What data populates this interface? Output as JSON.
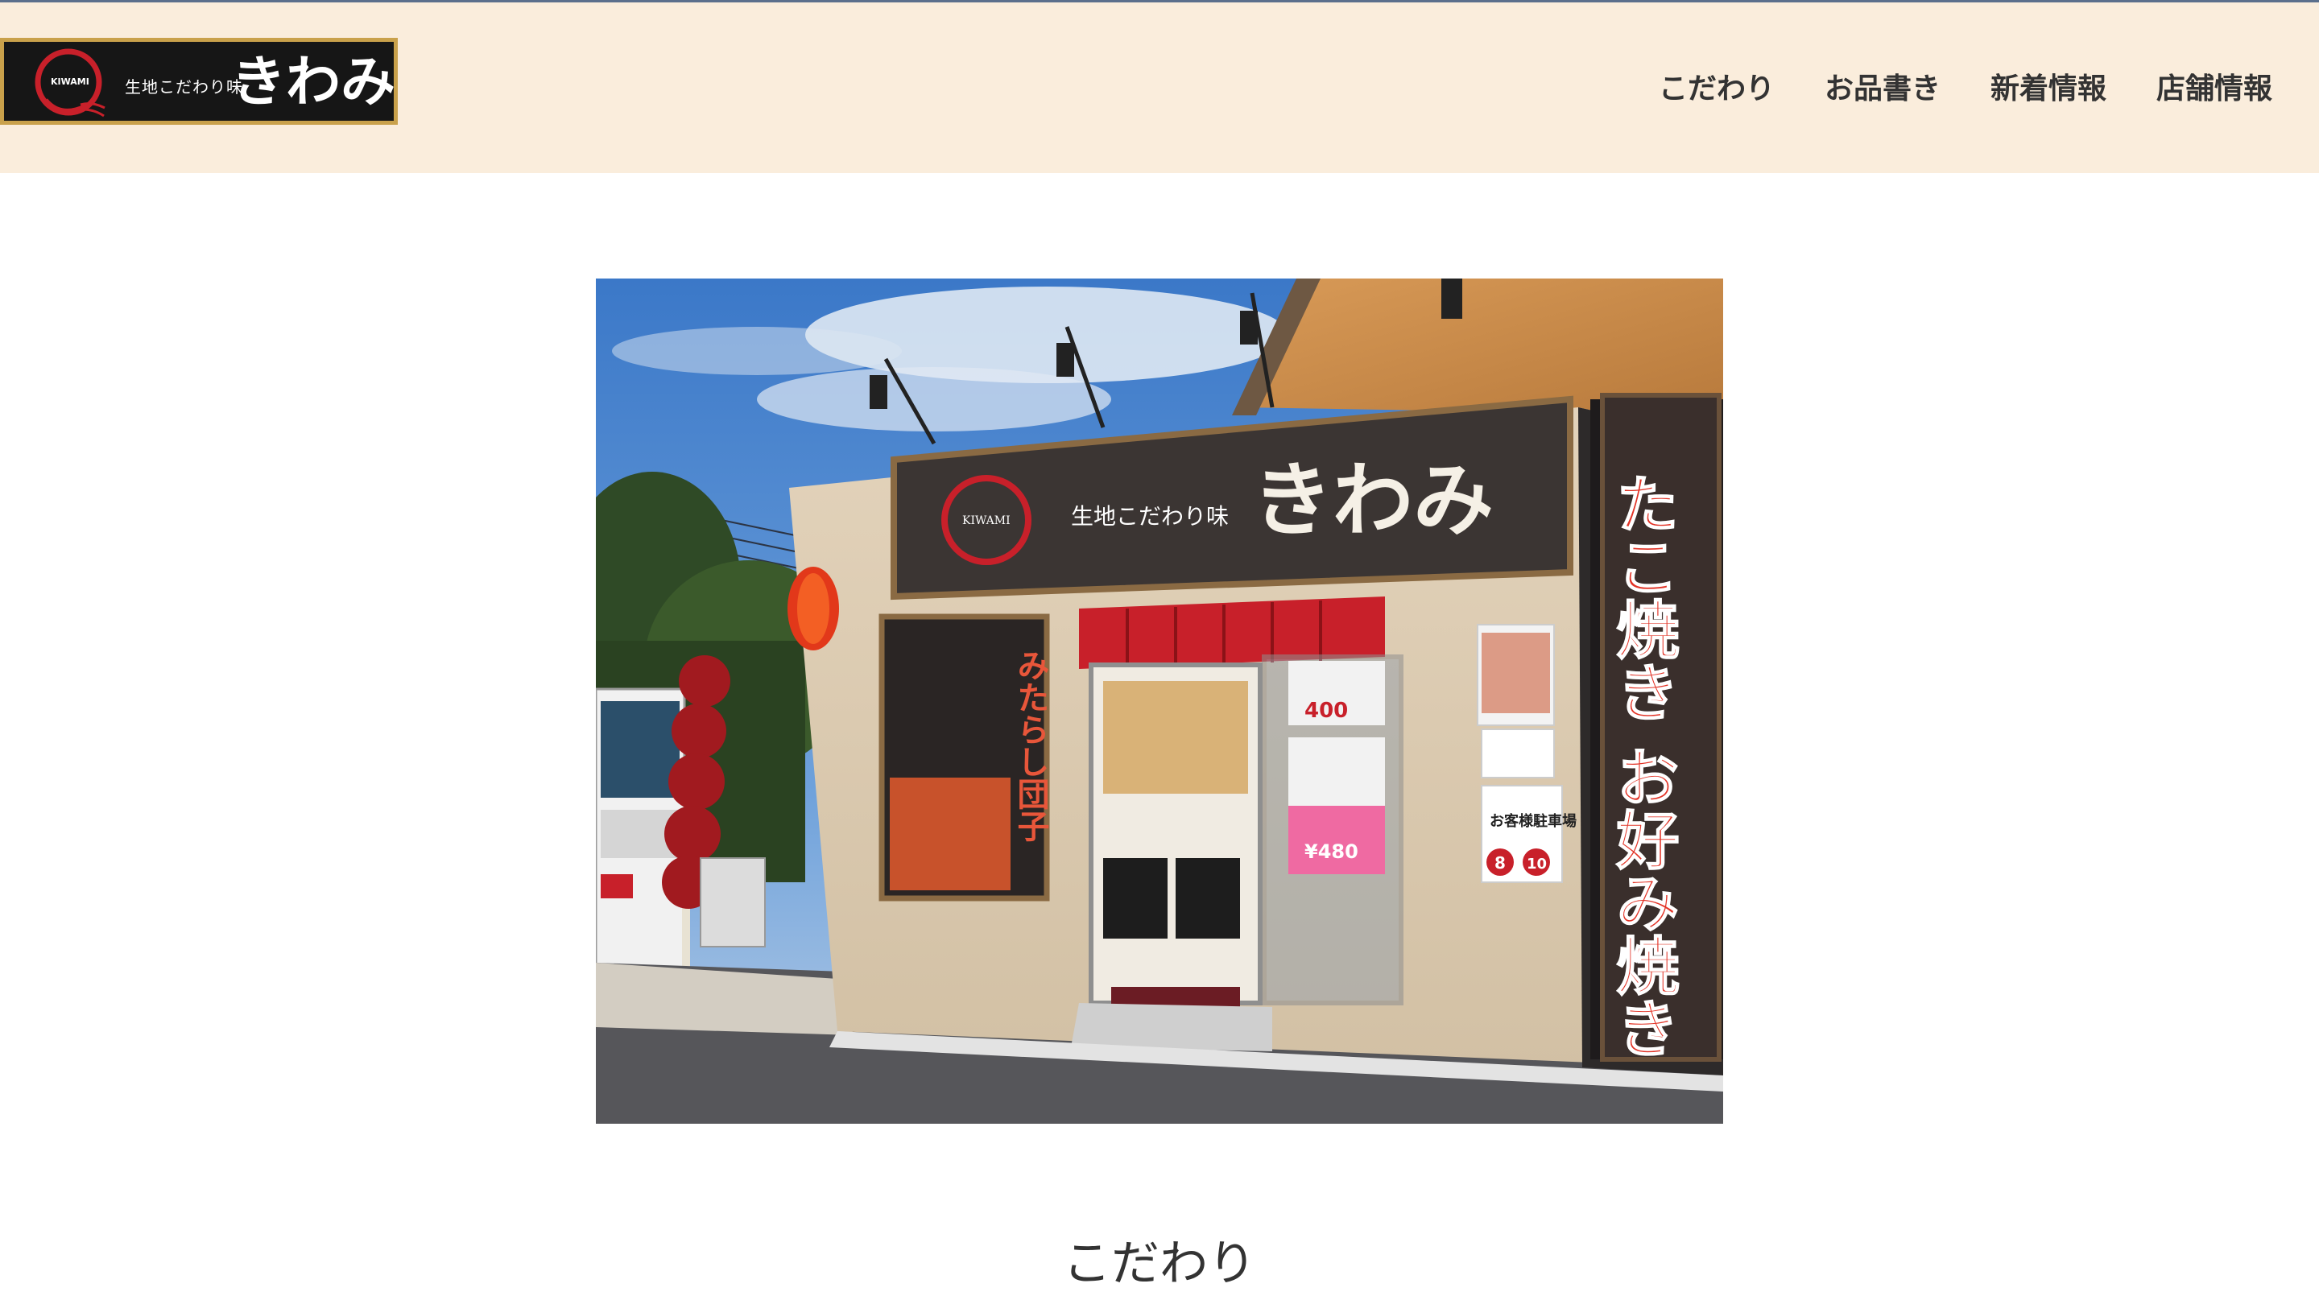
{
  "brand": {
    "logo_latin": "KIWAMI",
    "logo_sub": "生地こだわり味",
    "logo_main": "きわみ",
    "colors": {
      "header_bg": "#faeddc",
      "logo_bg": "#161616",
      "logo_border": "#c9a14b",
      "accent_red": "#c8202a"
    }
  },
  "nav": {
    "items": [
      {
        "label": "こだわり"
      },
      {
        "label": "お品書き"
      },
      {
        "label": "新着情報"
      },
      {
        "label": "店舗情報"
      }
    ]
  },
  "hero": {
    "sign_latin": "KIWAMI",
    "sign_sub": "生地こだわり味",
    "sign_main": "きわみ",
    "banner_right": "たこ焼き お好み焼き",
    "poster_left": "みたらし団子",
    "poster_price_1": "400",
    "poster_price_2": "¥480",
    "parking_text": "お客様駐車場",
    "parking_numbers": [
      "8",
      "10"
    ]
  },
  "section": {
    "heading": "こだわり"
  }
}
